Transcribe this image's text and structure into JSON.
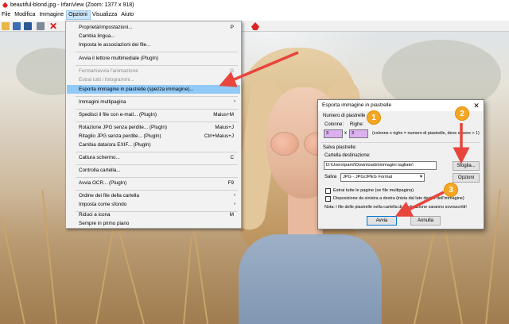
{
  "window": {
    "title": "beautiful-blond.jpg - IrfanView (Zoom: 1377 x 918)"
  },
  "menubar": [
    {
      "label": "File"
    },
    {
      "label": "Modifica"
    },
    {
      "label": "Immagine"
    },
    {
      "label": "Opzioni",
      "open": true
    },
    {
      "label": "Visualizza"
    },
    {
      "label": "Aiuto"
    }
  ],
  "toolbar_icons": [
    "open-folder-icon",
    "save-icon",
    "save-as-icon",
    "print-icon",
    "delete-icon",
    "irfanview-logo-icon"
  ],
  "options_menu": [
    {
      "label": "Proprietà/impostazioni...",
      "shortcut": "P",
      "disabled": false
    },
    {
      "label": "Cambia lingua...",
      "shortcut": "",
      "disabled": false
    },
    {
      "label": "Imposta le associazioni dei file...",
      "shortcut": "",
      "disabled": false
    },
    {
      "label": "Avvia il lettore multimediale (PlugIn)",
      "shortcut": "",
      "disabled": false
    },
    {
      "label": "Ferma/riavvia l'animazione",
      "shortcut": "G",
      "disabled": true
    },
    {
      "label": "Estrai tutti i fotogrammi...",
      "shortcut": "",
      "disabled": true
    },
    {
      "label": "Esporta immagine in piastrelle (spezza immagine)...",
      "shortcut": "",
      "disabled": false,
      "highlighted": true
    },
    {
      "label": "Immagini multipagina",
      "shortcut": "",
      "submenu": true
    },
    {
      "label": "Spedisci il file con e-mail... (PlugIn)",
      "shortcut": "Maius+M"
    },
    {
      "label": "Rotazione JPG senza perdite... (PlugIn)",
      "shortcut": "Maius+J"
    },
    {
      "label": "Ritaglio JPG senza perdite... (PlugIn)",
      "shortcut": "Ctrl+Maius+J"
    },
    {
      "label": "Cambia data/ora EXIF... (PlugIn)",
      "shortcut": ""
    },
    {
      "label": "Cattura schermo...",
      "shortcut": "C"
    },
    {
      "label": "Controlla cartella...",
      "shortcut": ""
    },
    {
      "label": "Avvia OCR... (PlugIn)",
      "shortcut": "F9"
    },
    {
      "label": "Ordine dei file della cartella",
      "shortcut": "",
      "submenu": true
    },
    {
      "label": "Imposta come sfondo",
      "shortcut": "",
      "submenu": true
    },
    {
      "label": "Riduci a icona",
      "shortcut": "M"
    },
    {
      "label": "Sempre in primo piano",
      "shortcut": ""
    }
  ],
  "dialog": {
    "title": "Esporta immagine in piastrelle",
    "close_glyph": "✕",
    "group_tiles": "Numero di piastrelle",
    "label_columns": "Colonne:",
    "label_rows": "Righe:",
    "columns_value": "3",
    "times_sign": "x",
    "rows_value": "3",
    "tiles_hint": "(colonne x righe = numero di piastrelle, deve essere > 1)",
    "group_save": "Salva piastrelle:",
    "label_dest": "Cartella destinazione:",
    "dest_path": "D:\\Users\\pami\\Downloads\\immagini tagliate\\",
    "browse_button": "Sfoglia...",
    "label_save_as": "Salva",
    "format_value": "JPG - JPG/JPEG Format",
    "options_button": "Opzioni",
    "check_all_pages": "Estrai tutte le pagine (se file multipagina)",
    "check_rtl": "Disposizione da sinistra a destra (inizia dal lato destro dell'immagine)",
    "note": "Nota: i file delle piastrelle nella cartella di destinazione saranno sovrascritti!",
    "start_button": "Avvia",
    "cancel_button": "Annulla"
  },
  "annotations": [
    {
      "number": "1"
    },
    {
      "number": "2"
    },
    {
      "number": "3"
    }
  ],
  "colors": {
    "menu_highlight": "#91c9f7",
    "badge": "#f5a623",
    "arrow": "#e8453c",
    "tile_fields": "#dcb0f0"
  }
}
